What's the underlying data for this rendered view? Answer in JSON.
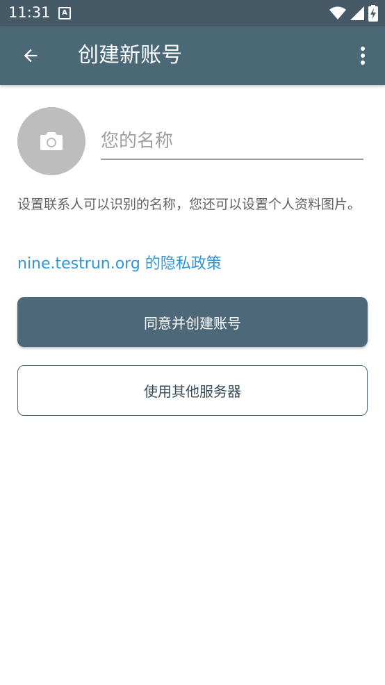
{
  "status_bar": {
    "time": "11:31",
    "notification_icon": "A",
    "icons": [
      "wifi-icon",
      "signal-icon",
      "battery-charging-icon"
    ]
  },
  "app_bar": {
    "title": "创建新账号",
    "back_icon": "arrow-left-icon",
    "menu_icon": "more-vert-icon"
  },
  "profile": {
    "avatar_icon": "camera-icon",
    "name_placeholder": "您的名称",
    "name_value": ""
  },
  "description": "设置联系人可以识别的名称，您还可以设置个人资料图片。",
  "privacy_link": "nine.testrun.org 的隐私政策",
  "buttons": {
    "agree_create": "同意并创建账号",
    "other_server": "使用其他服务器"
  },
  "colors": {
    "status_bar": "#455a66",
    "app_bar": "#4b6877",
    "primary_button": "#4c6879",
    "link": "#2e96d8",
    "avatar_bg": "#bdbdbd"
  }
}
